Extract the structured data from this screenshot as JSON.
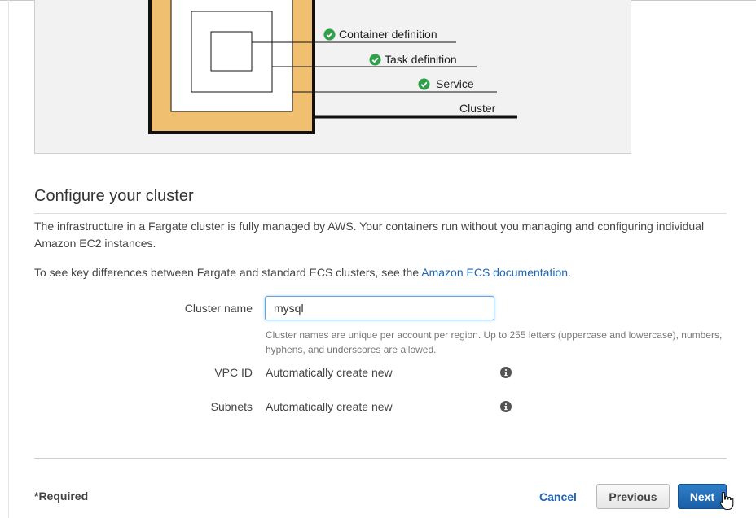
{
  "diagram": {
    "labels": {
      "container_definition": "Container definition",
      "task_definition": "Task definition",
      "service": "Service",
      "cluster": "Cluster"
    },
    "colors": {
      "cluster_fill": "#f0c070",
      "check": "#2ea04a"
    }
  },
  "section": {
    "title": "Configure your cluster",
    "intro": "The infrastructure in a Fargate cluster is fully managed by AWS. Your containers run without you managing and configuring individual Amazon EC2 instances.",
    "docs_prefix": "To see key differences between Fargate and standard ECS clusters, see the ",
    "docs_link": "Amazon ECS documentation",
    "docs_suffix": "."
  },
  "form": {
    "cluster_name": {
      "label": "Cluster name",
      "value": "mysql",
      "help": "Cluster names are unique per account per region. Up to 255 letters (uppercase and lowercase), numbers, hyphens, and underscores are allowed."
    },
    "vpc_id": {
      "label": "VPC ID",
      "value": "Automatically create new"
    },
    "subnets": {
      "label": "Subnets",
      "value": "Automatically create new"
    }
  },
  "footer": {
    "required": "*Required",
    "cancel": "Cancel",
    "previous": "Previous",
    "next": "Next"
  },
  "colors": {
    "link": "#1f66b4",
    "primary_button": "#1b5fa6"
  }
}
